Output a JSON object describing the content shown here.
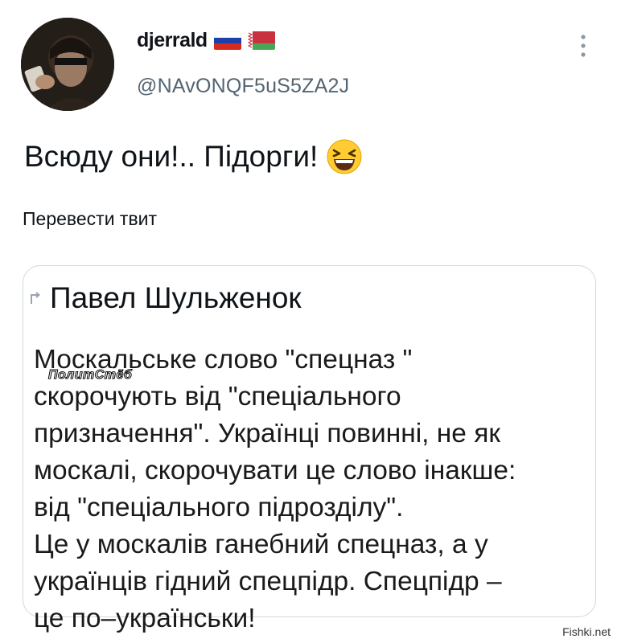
{
  "tweet": {
    "author": {
      "name": "djerrald",
      "handle": "@NAvONQF5uS5ZA2J",
      "flags": [
        "russia-flag",
        "belarus-flag"
      ]
    },
    "text": "Всюду они!.. Підорги!",
    "emoji": "grinning-squinting-face",
    "translate_label": "Перевести твит",
    "more_icon": "more-vertical-icon"
  },
  "quote": {
    "author": "Павел Шульженок",
    "icon": "retweet-icon",
    "lines": [
      "Москальське слово \"спецназ \"",
      "скорочують від \"спеціального",
      "призначення\". Українці повинні, не як",
      "москалі, скорочувати це слово інакше:",
      "від \"спеціального підрозділу\".",
      " Це у москалів ганебний спецназ, а у",
      "українців гідний спецпідр. Спецпідр –",
      "це по–українськи!"
    ]
  },
  "watermarks": {
    "overlay": "ПолитСтёб",
    "site": "Fishki.net"
  }
}
